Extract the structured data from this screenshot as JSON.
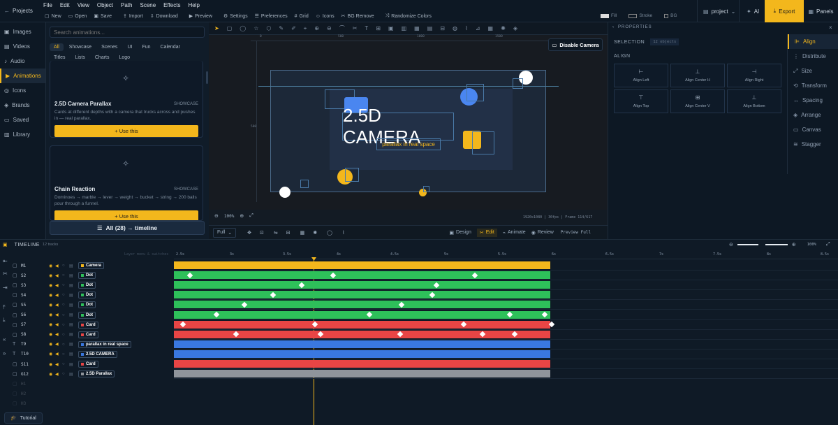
{
  "menu": {
    "projects": "Projects",
    "items": [
      "File",
      "Edit",
      "View",
      "Object",
      "Path",
      "Scene",
      "Effects",
      "Help"
    ],
    "toolbar": [
      "New",
      "Open",
      "Save",
      "Import",
      "Download",
      "Preview",
      "Settings",
      "Preferences",
      "Grid",
      "Icons",
      "BG Remove",
      "Randomize Colors"
    ],
    "fill": "Fill",
    "stroke": "Stroke",
    "bg": "BG",
    "project": "project",
    "ai": "AI",
    "export": "Export",
    "panels": "Panels"
  },
  "sidebar": [
    "Images",
    "Videos",
    "Audio",
    "Animations",
    "Icons",
    "Brands",
    "Saved",
    "Library"
  ],
  "library": {
    "search_placeholder": "Search animations...",
    "chips": [
      "All",
      "Showcase",
      "Scenes",
      "UI",
      "Fun",
      "Calendar",
      "Titles",
      "Lists",
      "Charts",
      "Logo"
    ],
    "cards": [
      {
        "title": "2.5D Camera Parallax",
        "tag": "SHOWCASE",
        "desc": "Cards at different depths with a camera that trucks across and pushes in — real parallax.",
        "btn": "Use this"
      },
      {
        "title": "Chain Reaction",
        "tag": "SHOWCASE",
        "desc": "Dominoes → marble → lever → weight → bucket → string → 200 balls pour through a funnel.",
        "btn": "Use this"
      }
    ],
    "all_timeline": "All (28) → timeline"
  },
  "canvas": {
    "ruler": [
      "0",
      "500",
      "1000",
      "1500"
    ],
    "vruler": [
      "500"
    ],
    "disable_camera": "Disable Camera",
    "title": "2.5D CAMERA",
    "subtitle": "parallax in real space",
    "zoom": "100%",
    "status": "1920x1080 | 30fps | Frame 114/617",
    "bottom": {
      "full": "Full",
      "design": "Design",
      "edit": "Edit",
      "animate": "Animate",
      "review": "Review",
      "preview_full": "Preview Full"
    }
  },
  "properties": {
    "header": "PROPERTIES",
    "selection": "SELECTION",
    "count": "12 objects",
    "align": "ALIGN",
    "buttons": [
      "Align Left",
      "Align Center H",
      "Align Right",
      "Align Top",
      "Align Center V",
      "Align Bottom"
    ],
    "tabs": [
      "Align",
      "Distribute",
      "Size",
      "Transform",
      "Spacing",
      "Arrange",
      "Canvas",
      "Stagger"
    ]
  },
  "timeline": {
    "title": "TIMELINE",
    "count": "12 tracks",
    "hint": "Layer menu & switches",
    "zoom": "100%",
    "tutorial": "Tutorial",
    "ticks": [
      "2.5s",
      "3s",
      "3.5s",
      "4s",
      "4.5s",
      "5s",
      "5.5s",
      "6s",
      "6.5s",
      "7s",
      "7.5s",
      "8s",
      "8.5s"
    ],
    "tracks": [
      {
        "id": "M1",
        "label": "Camera",
        "color": "#f3b71c"
      },
      {
        "id": "S2",
        "label": "Dot",
        "color": "#2ec05a"
      },
      {
        "id": "S3",
        "label": "Dot",
        "color": "#2ec05a"
      },
      {
        "id": "S4",
        "label": "Dot",
        "color": "#2ec05a"
      },
      {
        "id": "S5",
        "label": "Dot",
        "color": "#2ec05a"
      },
      {
        "id": "S6",
        "label": "Dot",
        "color": "#2ec05a"
      },
      {
        "id": "S7",
        "label": "Card",
        "color": "#e84545"
      },
      {
        "id": "S8",
        "label": "Card",
        "color": "#e84545"
      },
      {
        "id": "T9",
        "label": "parallax in real space",
        "color": "#3a78e0"
      },
      {
        "id": "T10",
        "label": "2.5D CAMERA",
        "color": "#3a78e0"
      },
      {
        "id": "S11",
        "label": "Card",
        "color": "#e84545"
      },
      {
        "id": "G12",
        "label": "2.5D Parallax",
        "color": "#8f949b"
      }
    ],
    "ghost": [
      "H1",
      "H2",
      "H3"
    ]
  }
}
